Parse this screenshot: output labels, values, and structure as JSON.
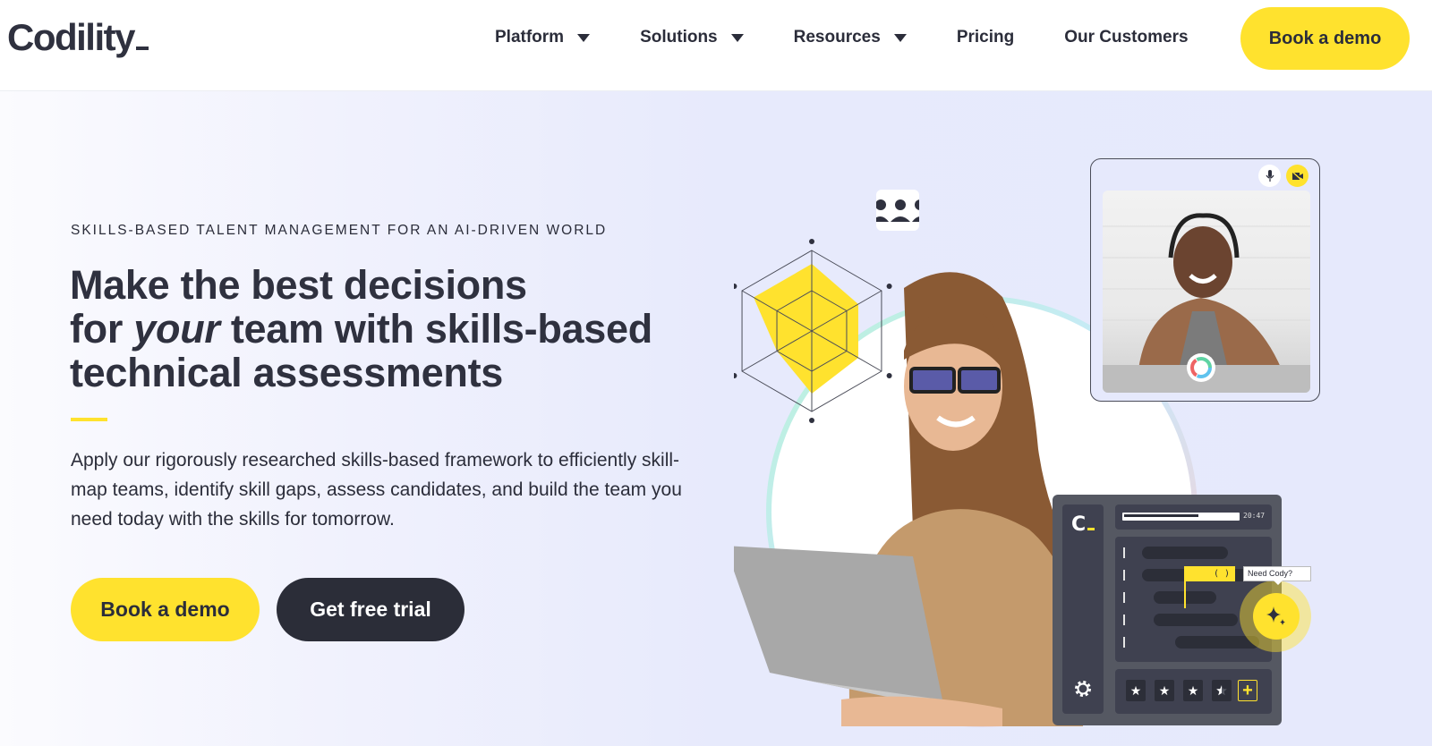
{
  "header": {
    "logo": "Codility",
    "nav": [
      {
        "label": "Platform",
        "has_dropdown": true
      },
      {
        "label": "Solutions",
        "has_dropdown": true
      },
      {
        "label": "Resources",
        "has_dropdown": true
      },
      {
        "label": "Pricing",
        "has_dropdown": false
      },
      {
        "label": "Our Customers",
        "has_dropdown": false
      }
    ],
    "cta_label": "Book a demo"
  },
  "hero": {
    "eyebrow": "SKILLS-BASED TALENT MANAGEMENT FOR AN AI-DRIVEN WORLD",
    "headline_line1": "Make the best decisions",
    "headline_for": "for ",
    "headline_your": "your",
    "headline_rest": " team with skills-based",
    "headline_line3": "technical assessments",
    "body": "Apply our rigorously researched skills-based framework to efficiently skill-map teams, identify skill gaps, assess candidates, and build the team you need today with the skills for tomorrow.",
    "primary_cta": "Book a demo",
    "secondary_cta": "Get free trial"
  },
  "illustration": {
    "radar_values": [
      0.75,
      0.6,
      0.6,
      0.7,
      0.45,
      0.75
    ],
    "video_call": {
      "mic_icon": "microphone-icon",
      "camera_icon": "camera-off-icon"
    },
    "editor": {
      "logo": "C",
      "timer": "20:47",
      "progress": 0.65,
      "flag_text": "( )",
      "cody_tooltip": "Need Cody?",
      "rating_stars": 3.5,
      "star_glyph": "★",
      "plus_glyph": "+"
    }
  },
  "colors": {
    "brand_yellow": "#ffe22e",
    "dark": "#2b2d38",
    "hero_bg": "#e6e9fc"
  }
}
